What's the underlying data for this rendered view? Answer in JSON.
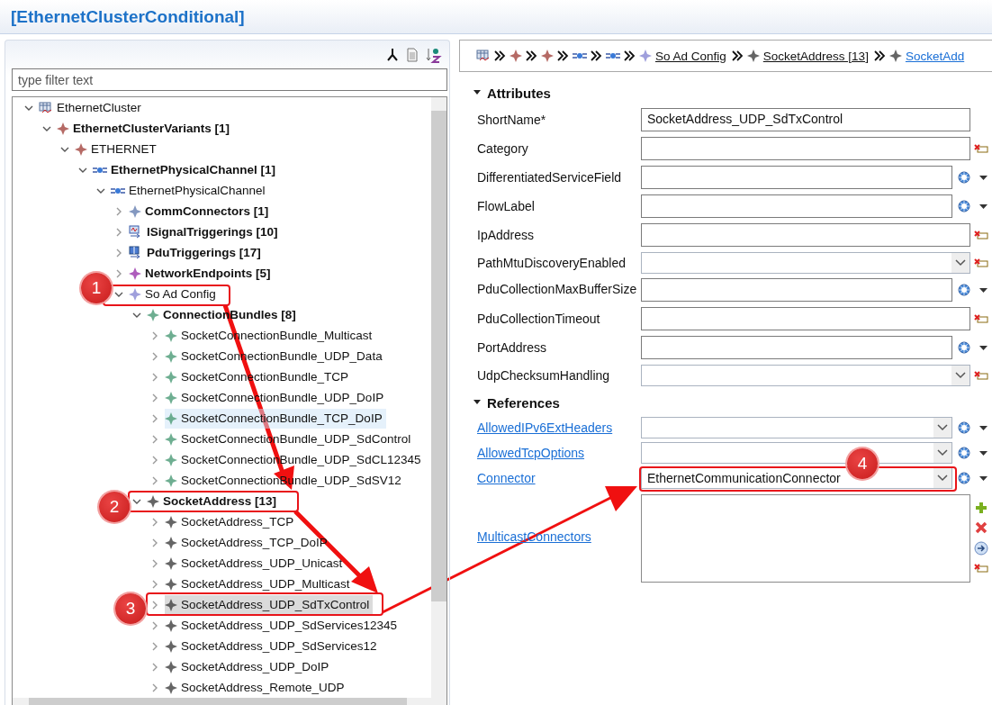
{
  "title": "[EthernetClusterConditional]",
  "filter": {
    "placeholder": "type filter text"
  },
  "tree": [
    {
      "label": "EthernetCluster",
      "kind": "cluster",
      "bold": false,
      "expanded": true,
      "selected": false,
      "hovered": false,
      "children": [
        {
          "label": "EthernetClusterVariants [1]",
          "kind": "variant",
          "bold": true,
          "expanded": true,
          "selected": false,
          "hovered": false,
          "children": [
            {
              "label": "ETHERNET",
              "kind": "variant",
              "bold": false,
              "expanded": true,
              "selected": false,
              "hovered": false,
              "children": [
                {
                  "label": "EthernetPhysicalChannel [1]",
                  "kind": "channel",
                  "bold": true,
                  "expanded": true,
                  "selected": false,
                  "hovered": false,
                  "children": [
                    {
                      "label": "EthernetPhysicalChannel",
                      "kind": "channel",
                      "bold": false,
                      "expanded": true,
                      "selected": false,
                      "hovered": false,
                      "children": [
                        {
                          "label": "CommConnectors [1]",
                          "kind": "comm",
                          "bold": true,
                          "expanded": false,
                          "selected": false,
                          "hovered": false
                        },
                        {
                          "label": "ISignalTriggerings [10]",
                          "kind": "signal",
                          "bold": true,
                          "expanded": false,
                          "selected": false,
                          "hovered": false
                        },
                        {
                          "label": "PduTriggerings [17]",
                          "kind": "pdu",
                          "bold": true,
                          "expanded": false,
                          "selected": false,
                          "hovered": false
                        },
                        {
                          "label": "NetworkEndpoints [5]",
                          "kind": "endpoint",
                          "bold": true,
                          "expanded": false,
                          "selected": false,
                          "hovered": false
                        },
                        {
                          "label": "So Ad Config",
                          "kind": "config",
                          "bold": false,
                          "expanded": true,
                          "selected": false,
                          "hovered": false,
                          "children": [
                            {
                              "label": "ConnectionBundles [8]",
                              "kind": "bundle",
                              "bold": true,
                              "expanded": true,
                              "selected": false,
                              "hovered": false,
                              "children": [
                                {
                                  "label": "SocketConnectionBundle_Multicast",
                                  "kind": "bundle",
                                  "bold": false,
                                  "expanded": false,
                                  "selected": false,
                                  "hovered": false
                                },
                                {
                                  "label": "SocketConnectionBundle_UDP_Data",
                                  "kind": "bundle",
                                  "bold": false,
                                  "expanded": false,
                                  "selected": false,
                                  "hovered": false
                                },
                                {
                                  "label": "SocketConnectionBundle_TCP",
                                  "kind": "bundle",
                                  "bold": false,
                                  "expanded": false,
                                  "selected": false,
                                  "hovered": false
                                },
                                {
                                  "label": "SocketConnectionBundle_UDP_DoIP",
                                  "kind": "bundle",
                                  "bold": false,
                                  "expanded": false,
                                  "selected": false,
                                  "hovered": false
                                },
                                {
                                  "label": "SocketConnectionBundle_TCP_DoIP",
                                  "kind": "bundle",
                                  "bold": false,
                                  "expanded": false,
                                  "selected": false,
                                  "hovered": true
                                },
                                {
                                  "label": "SocketConnectionBundle_UDP_SdControl",
                                  "kind": "bundle",
                                  "bold": false,
                                  "expanded": false,
                                  "selected": false,
                                  "hovered": false
                                },
                                {
                                  "label": "SocketConnectionBundle_UDP_SdCL12345",
                                  "kind": "bundle",
                                  "bold": false,
                                  "expanded": false,
                                  "selected": false,
                                  "hovered": false
                                },
                                {
                                  "label": "SocketConnectionBundle_UDP_SdSV12",
                                  "kind": "bundle",
                                  "bold": false,
                                  "expanded": false,
                                  "selected": false,
                                  "hovered": false
                                }
                              ]
                            },
                            {
                              "label": "SocketAddress [13]",
                              "kind": "address",
                              "bold": true,
                              "expanded": true,
                              "selected": false,
                              "hovered": false,
                              "children": [
                                {
                                  "label": "SocketAddress_TCP",
                                  "kind": "address",
                                  "bold": false,
                                  "expanded": false,
                                  "selected": false,
                                  "hovered": false
                                },
                                {
                                  "label": "SocketAddress_TCP_DoIP",
                                  "kind": "address",
                                  "bold": false,
                                  "expanded": false,
                                  "selected": false,
                                  "hovered": false
                                },
                                {
                                  "label": "SocketAddress_UDP_Unicast",
                                  "kind": "address",
                                  "bold": false,
                                  "expanded": false,
                                  "selected": false,
                                  "hovered": false
                                },
                                {
                                  "label": "SocketAddress_UDP_Multicast",
                                  "kind": "address",
                                  "bold": false,
                                  "expanded": false,
                                  "selected": false,
                                  "hovered": false
                                },
                                {
                                  "label": "SocketAddress_UDP_SdTxControl",
                                  "kind": "address",
                                  "bold": false,
                                  "expanded": false,
                                  "selected": true,
                                  "hovered": false
                                },
                                {
                                  "label": "SocketAddress_UDP_SdServices12345",
                                  "kind": "address",
                                  "bold": false,
                                  "expanded": false,
                                  "selected": false,
                                  "hovered": false
                                },
                                {
                                  "label": "SocketAddress_UDP_SdServices12",
                                  "kind": "address",
                                  "bold": false,
                                  "expanded": false,
                                  "selected": false,
                                  "hovered": false
                                },
                                {
                                  "label": "SocketAddress_UDP_DoIP",
                                  "kind": "address",
                                  "bold": false,
                                  "expanded": false,
                                  "selected": false,
                                  "hovered": false
                                },
                                {
                                  "label": "SocketAddress_Remote_UDP",
                                  "kind": "address",
                                  "bold": false,
                                  "expanded": false,
                                  "selected": false,
                                  "hovered": false
                                }
                              ]
                            }
                          ]
                        }
                      ]
                    }
                  ]
                }
              ]
            }
          ]
        }
      ]
    }
  ],
  "breadcrumb": [
    {
      "kind": "cluster"
    },
    {
      "kind": "variant"
    },
    {
      "kind": "variant"
    },
    {
      "kind": "channel"
    },
    {
      "kind": "channel"
    },
    {
      "kind": "config",
      "label": "So Ad Config",
      "active": false
    },
    {
      "kind": "address",
      "label": "SocketAddress [13]",
      "active": false
    },
    {
      "kind": "address",
      "label": "SocketAdd",
      "active": true
    }
  ],
  "sections": [
    {
      "title": "Attributes",
      "expanded": true,
      "fields": [
        {
          "label": "ShortName*",
          "link": false,
          "kind": "text",
          "value": "SocketAddress_UDP_SdTxControl"
        },
        {
          "label": "Category",
          "link": false,
          "kind": "text",
          "buttons": [
            {
              "kind": "clear"
            }
          ]
        },
        {
          "label": "DifferentiatedServiceField",
          "link": false,
          "kind": "text",
          "buttons": [
            {
              "kind": "menu"
            },
            {
              "kind": "dropdown"
            }
          ]
        },
        {
          "label": "FlowLabel",
          "link": false,
          "kind": "text",
          "buttons": [
            {
              "kind": "menu"
            },
            {
              "kind": "dropdown"
            }
          ]
        },
        {
          "label": "IpAddress",
          "link": false,
          "kind": "text",
          "buttons": [
            {
              "kind": "clear"
            }
          ]
        },
        {
          "label": "PathMtuDiscoveryEnabled",
          "link": false,
          "kind": "combo",
          "buttons": [
            {
              "kind": "clear"
            }
          ]
        },
        {
          "label": "PduCollectionMaxBufferSize",
          "link": false,
          "kind": "text",
          "buttons": [
            {
              "kind": "menu"
            },
            {
              "kind": "dropdown"
            }
          ]
        },
        {
          "label": "PduCollectionTimeout",
          "link": false,
          "kind": "text",
          "buttons": [
            {
              "kind": "clear"
            }
          ]
        },
        {
          "label": "PortAddress",
          "link": false,
          "kind": "text",
          "buttons": [
            {
              "kind": "menu"
            },
            {
              "kind": "dropdown"
            }
          ]
        },
        {
          "label": "UdpChecksumHandling",
          "link": false,
          "kind": "combo",
          "buttons": [
            {
              "kind": "clear"
            }
          ]
        }
      ]
    },
    {
      "title": "References",
      "expanded": true,
      "fields": [
        {
          "label": "AllowedIPv6ExtHeaders",
          "link": true,
          "kind": "combo",
          "buttons": [
            {
              "kind": "menu"
            },
            {
              "kind": "dropdown"
            }
          ]
        },
        {
          "label": "AllowedTcpOptions",
          "link": true,
          "kind": "combo",
          "buttons": [
            {
              "kind": "menu"
            },
            {
              "kind": "dropdown"
            }
          ]
        },
        {
          "label": "Connector",
          "link": true,
          "kind": "combo",
          "value": "EthernetCommunicationConnector",
          "buttons": [
            {
              "kind": "menu"
            },
            {
              "kind": "dropdown"
            }
          ]
        },
        {
          "label": "MulticastConnectors",
          "link": true,
          "kind": "list",
          "buttons": [
            {
              "kind": "add"
            },
            {
              "kind": "delete"
            },
            {
              "kind": "move"
            },
            {
              "kind": "clear"
            }
          ]
        }
      ]
    }
  ],
  "annotations": [
    {
      "number": "1"
    },
    {
      "number": "2"
    },
    {
      "number": "3"
    },
    {
      "number": "4"
    }
  ]
}
